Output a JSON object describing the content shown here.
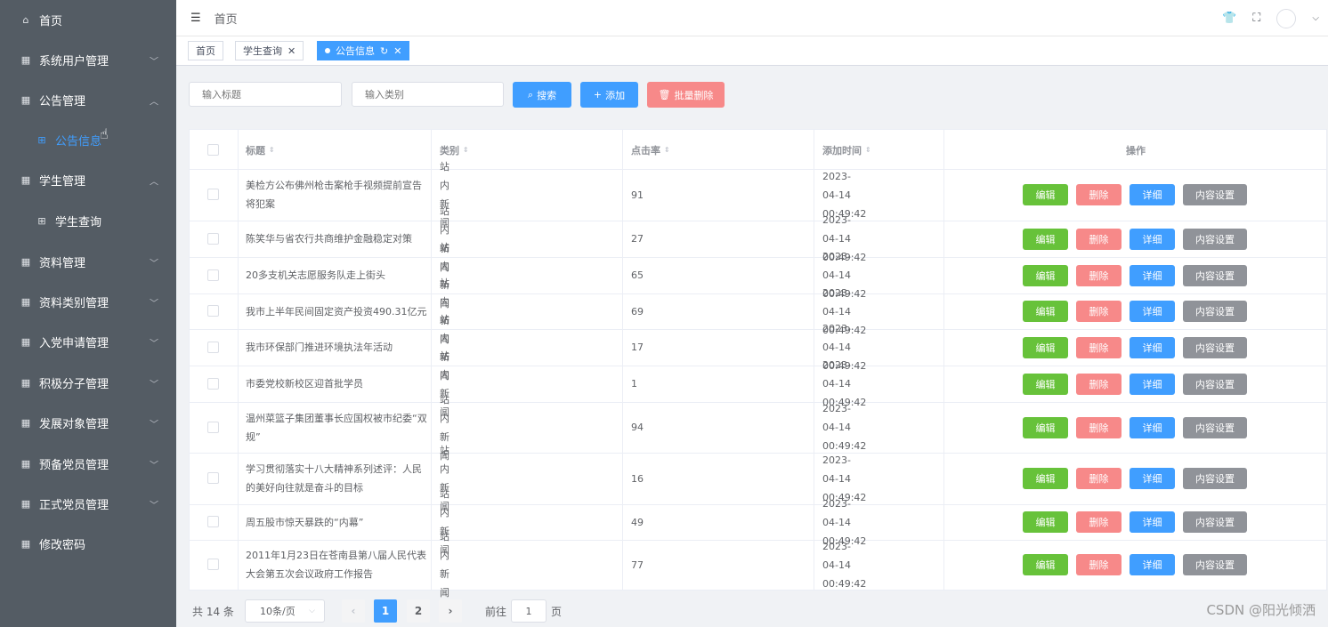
{
  "sidebar": {
    "items": [
      {
        "label": "首页",
        "icon": "home-icon",
        "arrow": ""
      },
      {
        "label": "系统用户管理",
        "icon": "grid-icon",
        "arrow": "chevron-down"
      },
      {
        "label": "公告管理",
        "icon": "grid-icon",
        "arrow": "chevron-up"
      },
      {
        "label": "公告信息",
        "icon": "apps-icon",
        "arrow": "",
        "active": true
      },
      {
        "label": "学生管理",
        "icon": "grid-icon",
        "arrow": "chevron-up"
      },
      {
        "label": "学生查询",
        "icon": "apps-icon",
        "arrow": ""
      },
      {
        "label": "资料管理",
        "icon": "grid-icon",
        "arrow": "chevron-down"
      },
      {
        "label": "资料类别管理",
        "icon": "grid-icon",
        "arrow": "chevron-down"
      },
      {
        "label": "入党申请管理",
        "icon": "grid-icon",
        "arrow": "chevron-down"
      },
      {
        "label": "积极分子管理",
        "icon": "grid-icon",
        "arrow": "chevron-down"
      },
      {
        "label": "发展对象管理",
        "icon": "grid-icon",
        "arrow": "chevron-down"
      },
      {
        "label": "预备党员管理",
        "icon": "grid-icon",
        "arrow": "chevron-down"
      },
      {
        "label": "正式党员管理",
        "icon": "grid-icon",
        "arrow": "chevron-down"
      },
      {
        "label": "修改密码",
        "icon": "grid-icon",
        "arrow": ""
      }
    ]
  },
  "header": {
    "breadcrumb": "首页",
    "icons": [
      "hamburger-icon",
      "shirt-icon",
      "fullscreen-icon",
      "avatar",
      "chevron-down-icon"
    ]
  },
  "tags": [
    {
      "label": "首页",
      "closable": false,
      "active": false
    },
    {
      "label": "学生查询",
      "closable": true,
      "active": false
    },
    {
      "label": "公告信息",
      "closable": true,
      "active": true
    }
  ],
  "toolbar": {
    "title_placeholder": "输入标题",
    "type_placeholder": "输入类别",
    "search_label": "搜索",
    "add_label": "添加",
    "batch_delete_label": "批量删除"
  },
  "colors": {
    "sidebar_bg": "#545c64",
    "primary": "#409eff",
    "success": "#67c23a",
    "danger": "#f78989",
    "info": "#909399"
  },
  "table": {
    "columns": [
      "标题",
      "类别",
      "点击率",
      "添加时间",
      "操作"
    ],
    "actions": {
      "edit": "编辑",
      "delete": "删除",
      "detail": "详细",
      "content": "内容设置"
    },
    "rows": [
      {
        "title": "美检方公布佛州枪击案枪手视频提前宣告将犯案",
        "type": "站内新闻",
        "clicks": "91",
        "time": "2023-04-14 00:49:42"
      },
      {
        "title": "陈笑华与省农行共商维护金融稳定对策",
        "type": "站内新闻",
        "clicks": "27",
        "time": "2023-04-14 00:49:42"
      },
      {
        "title": "20多支机关志愿服务队走上街头",
        "type": "站内新闻",
        "clicks": "65",
        "time": "2023-04-14 00:49:42"
      },
      {
        "title": "我市上半年民间固定资产投资490.31亿元",
        "type": "站内新闻",
        "clicks": "69",
        "time": "2023-04-14 00:49:42"
      },
      {
        "title": "我市环保部门推进环境执法年活动",
        "type": "站内新闻",
        "clicks": "17",
        "time": "2023-04-14 00:49:42"
      },
      {
        "title": "市委党校新校区迎首批学员",
        "type": "站内新闻",
        "clicks": "1",
        "time": "2023-04-14 00:49:42"
      },
      {
        "title": "温州菜篮子集团董事长应国权被市纪委“双规”",
        "type": "站内新闻",
        "clicks": "94",
        "time": "2023-04-14 00:49:42"
      },
      {
        "title": "学习贯彻落实十八大精神系列述评：人民的美好向往就是奋斗的目标",
        "type": "站内新闻",
        "clicks": "16",
        "time": "2023-04-14 00:49:42"
      },
      {
        "title": "周五股市惊天暴跌的“内幕”",
        "type": "站内新闻",
        "clicks": "49",
        "time": "2023-04-14 00:49:42"
      },
      {
        "title": "2011年1月23日在苍南县第八届人民代表大会第五次会议政府工作报告",
        "type": "站内新闻",
        "clicks": "77",
        "time": "2023-04-14 00:49:42"
      }
    ]
  },
  "pagination": {
    "total_text": "共 14 条",
    "page_size": "10条/页",
    "pages": [
      "1",
      "2"
    ],
    "current_page": "1",
    "goto_prefix": "前往",
    "goto_value": "1",
    "goto_suffix": "页"
  },
  "watermark": "CSDN @阳光倾洒"
}
